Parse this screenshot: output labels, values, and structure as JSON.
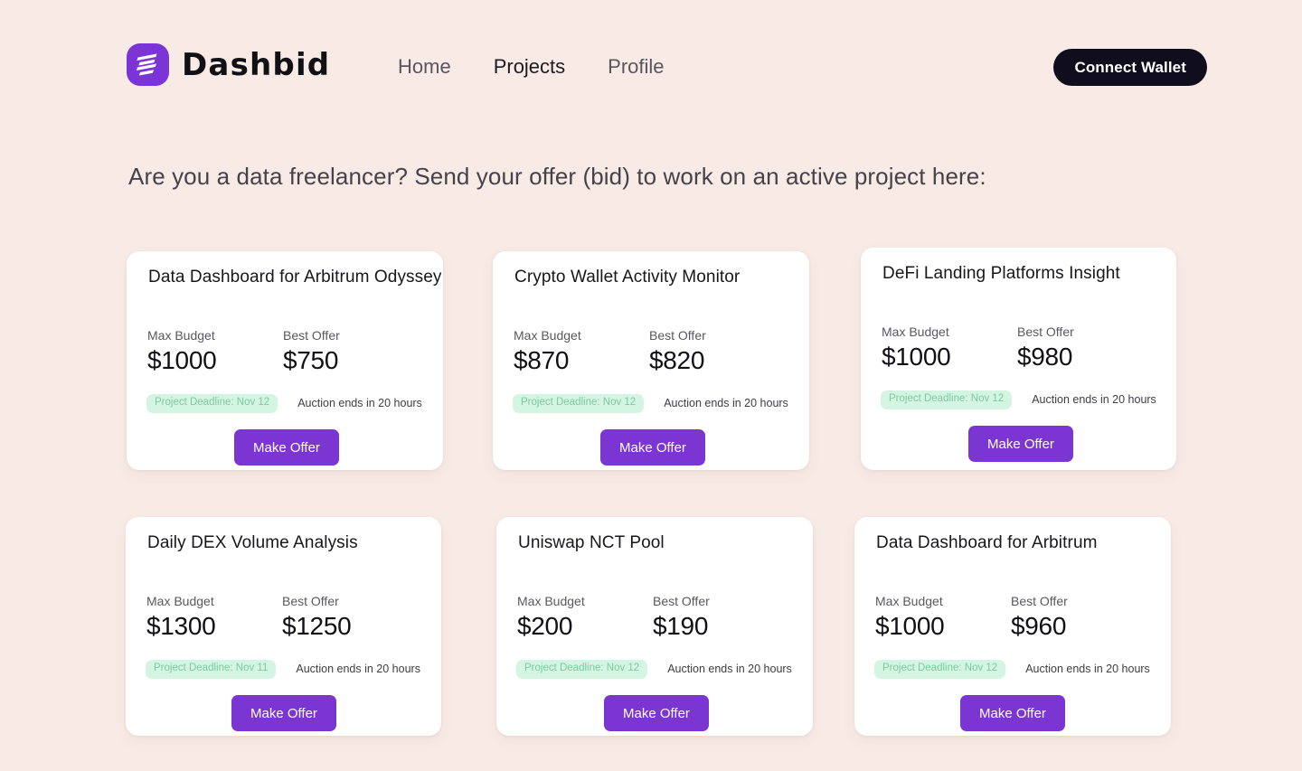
{
  "brand": {
    "name": "Dashbid",
    "logo_icon": "dashbid-stripes-logo",
    "logo_color": "#7b35d6"
  },
  "nav": {
    "items": [
      {
        "label": "Home",
        "active": false
      },
      {
        "label": "Projects",
        "active": true
      },
      {
        "label": "Profile",
        "active": false
      }
    ]
  },
  "header": {
    "connect_wallet_label": "Connect Wallet",
    "connect_wallet_color": "#100d1c"
  },
  "page": {
    "background_color": "#f8eae5",
    "headline": "Are you a data freelancer? Send your offer (bid) to work on an active project here:"
  },
  "labels": {
    "max_budget": "Max Budget",
    "best_offer": "Best Offer",
    "make_offer": "Make Offer"
  },
  "theme": {
    "accent_purple": "#7a35d2",
    "badge_bg": "#d4f5e2",
    "badge_text": "#7ec9a2",
    "card_bg": "#ffffff"
  },
  "projects": [
    {
      "title": "Data Dashboard for Arbitrum Odyssey",
      "max_budget": "$1000",
      "best_offer": "$750",
      "deadline_badge": "Project Deadline: Nov 12",
      "auction_text": "Auction ends in 20 hours",
      "cta": "Make Offer"
    },
    {
      "title": "Crypto Wallet Activity Monitor",
      "max_budget": "$870",
      "best_offer": "$820",
      "deadline_badge": "Project Deadline: Nov 12",
      "auction_text": "Auction ends in 20 hours",
      "cta": "Make Offer"
    },
    {
      "title": "DeFi Landing Platforms Insight",
      "max_budget": "$1000",
      "best_offer": "$980",
      "deadline_badge": "Project Deadline: Nov 12",
      "auction_text": "Auction ends in 20 hours",
      "cta": "Make Offer"
    },
    {
      "title": "Daily DEX Volume Analysis",
      "max_budget": "$1300",
      "best_offer": "$1250",
      "deadline_badge": "Project Deadline: Nov 11",
      "auction_text": "Auction ends in 20 hours",
      "cta": "Make Offer"
    },
    {
      "title": "Uniswap NCT Pool",
      "max_budget": "$200",
      "best_offer": "$190",
      "deadline_badge": "Project Deadline: Nov 12",
      "auction_text": "Auction ends in 20 hours",
      "cta": "Make Offer"
    },
    {
      "title": "Data Dashboard for Arbitrum",
      "max_budget": "$1000",
      "best_offer": "$960",
      "deadline_badge": "Project Deadline: Nov 12",
      "auction_text": "Auction ends in 20 hours",
      "cta": "Make Offer"
    }
  ]
}
